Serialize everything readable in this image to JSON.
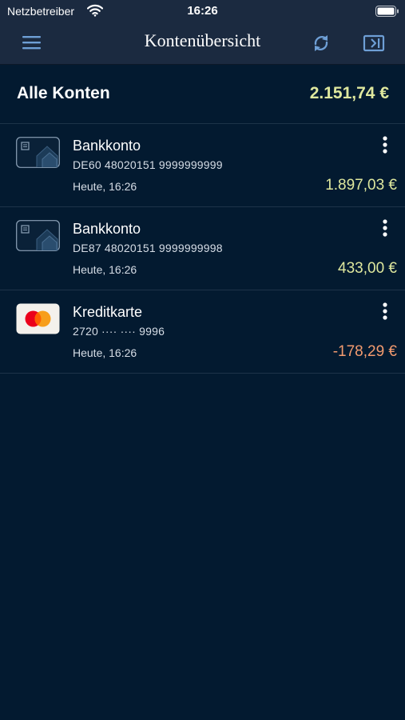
{
  "status_bar": {
    "carrier": "Netzbetreiber",
    "time": "16:26"
  },
  "nav": {
    "title": "Kontenübersicht",
    "menu_icon": "hamburger-menu-icon",
    "refresh_icon": "refresh-icon",
    "logout_icon": "logout-icon"
  },
  "summary": {
    "label": "Alle Konten",
    "amount": "2.151,74 €"
  },
  "accounts": [
    {
      "name": "Bankkonto",
      "number": "DE60 48020151 9999999999",
      "updated": "Heute, 16:26",
      "amount": "1.897,03 €",
      "type": "bank-card-icon",
      "sign": "positive"
    },
    {
      "name": "Bankkonto",
      "number": "DE87 48020151 9999999998",
      "updated": "Heute, 16:26",
      "amount": "433,00 €",
      "type": "bank-card-icon",
      "sign": "positive"
    },
    {
      "name": "Kreditkarte",
      "number": "2720 ···· ···· 9996",
      "updated": "Heute, 16:26",
      "amount": "-178,29 €",
      "type": "mastercard-icon",
      "sign": "negative"
    }
  ],
  "colors": {
    "background": "#031a30",
    "navbar": "#1b2a40",
    "positive": "#dfe89e",
    "negative": "#f39b6f",
    "accent": "#6e9fd6"
  }
}
